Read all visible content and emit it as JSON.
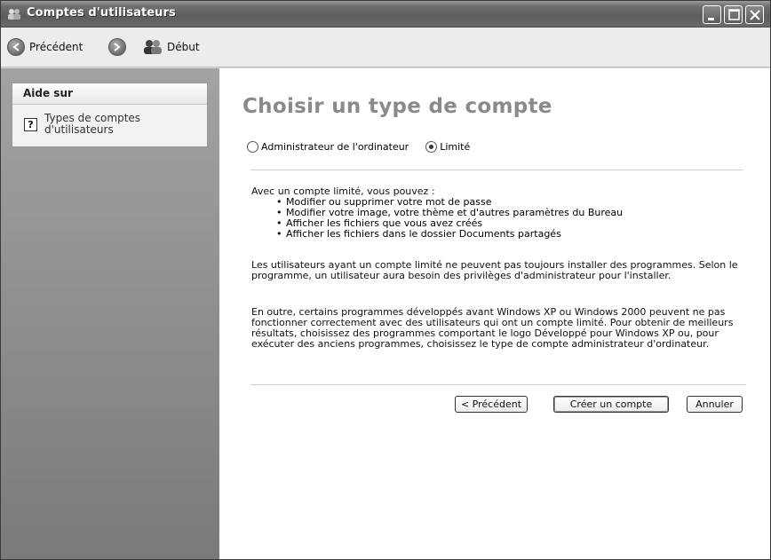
{
  "window": {
    "title": "Comptes d'utilisateurs"
  },
  "nav": {
    "back_label": "Précédent",
    "home_label": "Début"
  },
  "sidebar": {
    "help_header": "Aide sur",
    "items": [
      {
        "label": "Types de comptes d'utilisateurs",
        "icon": "help-icon"
      }
    ]
  },
  "main": {
    "title": "Choisir un type de compte",
    "options": [
      {
        "label": "Administrateur de l'ordinateur",
        "checked": false
      },
      {
        "label": "Limité",
        "checked": true
      }
    ],
    "intro": "Avec un compte limité, vous pouvez :",
    "bullets": [
      "Modifier ou supprimer votre mot de passe",
      "Modifier votre image, votre thème et d'autres paramètres du Bureau",
      "Afficher les fichiers que vous avez créés",
      "Afficher les fichiers dans le dossier Documents partagés"
    ],
    "para1": "Les utilisateurs ayant un compte limité ne peuvent pas toujours installer des programmes. Selon le programme, un utilisateur aura besoin des privilèges d'administrateur pour l'installer.",
    "para2": "En outre, certains programmes développés avant Windows XP ou Windows 2000 peuvent ne pas fonctionner correctement avec des utilisateurs qui ont un compte limité. Pour obtenir de meilleurs résultats, choisissez des programmes comportant le logo Développé pour Windows XP ou, pour exécuter des anciens programmes, choisissez le type de compte administrateur d'ordinateur.",
    "buttons": {
      "prev": "< Précédent",
      "create": "Créer un compte",
      "cancel": "Annuler"
    }
  }
}
